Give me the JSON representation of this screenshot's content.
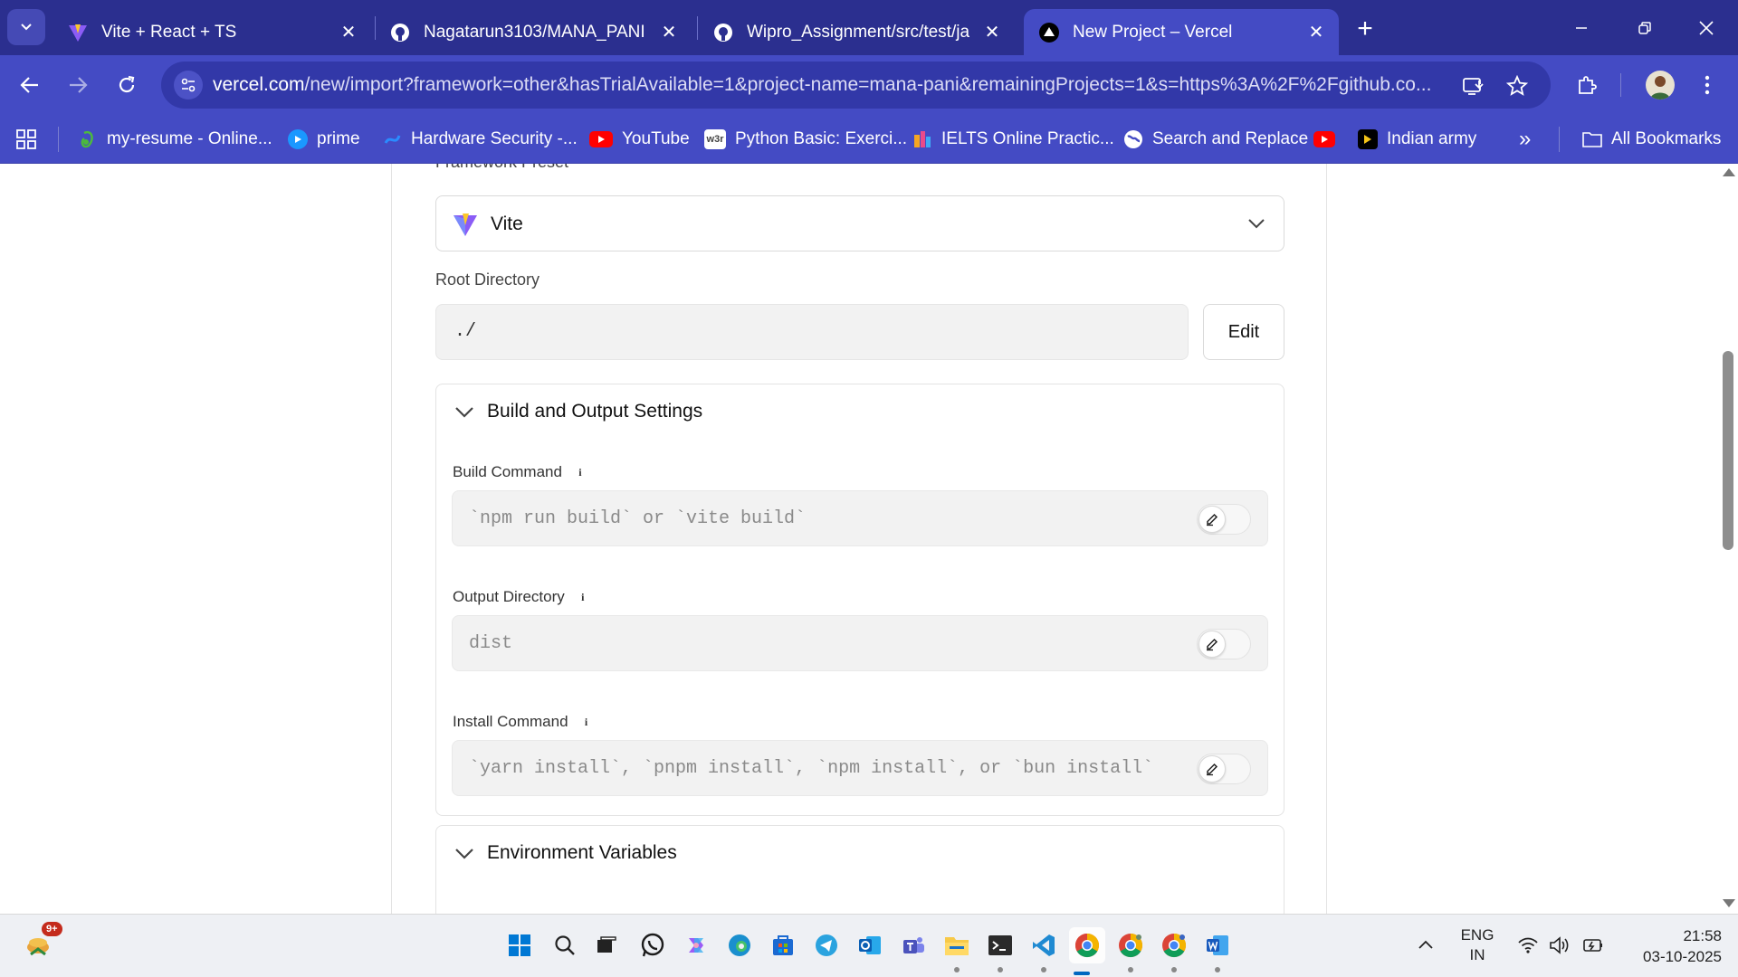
{
  "browser": {
    "tabs": [
      {
        "title": "Vite + React + TS",
        "icon": "vite-icon",
        "active": false
      },
      {
        "title": "Nagatarun3103/MANA_PANI",
        "icon": "github-icon",
        "active": false
      },
      {
        "title": "Wipro_Assignment/src/test/java",
        "icon": "github-icon",
        "active": false
      },
      {
        "title": "New Project – Vercel",
        "icon": "vercel-icon",
        "active": true
      }
    ],
    "new_tab_label": "+",
    "url_host": "vercel.com",
    "url_path": "/new/import?framework=other&hasTrialAvailable=1&project-name=mana-pani&remainingProjects=1&s=https%3A%2F%2Fgithub.co...",
    "bookmarks": [
      {
        "label": "my-resume - Online...",
        "icon": "overleaf-icon"
      },
      {
        "label": "prime",
        "icon": "prime-icon"
      },
      {
        "label": "Hardware Security -...",
        "icon": "hardware-icon"
      },
      {
        "label": "YouTube",
        "icon": "youtube-icon"
      },
      {
        "label": "Python Basic: Exerci...",
        "icon": "w3r-icon"
      },
      {
        "label": "IELTS Online Practic...",
        "icon": "ielts-icon"
      },
      {
        "label": "Search and Replace",
        "icon": "globe-icon"
      },
      {
        "label": "",
        "icon": "youtube-icon"
      },
      {
        "label": "Indian army",
        "icon": "play-icon"
      }
    ],
    "more_bookmarks_label": "»",
    "all_bookmarks_label": "All Bookmarks"
  },
  "form": {
    "framework_label": "Framework Preset",
    "framework_value": "Vite",
    "root_label": "Root Directory",
    "root_value": "./",
    "edit_label": "Edit",
    "build_section_title": "Build and Output Settings",
    "build_command_label": "Build Command",
    "build_command_placeholder": "`npm run build` or `vite build`",
    "output_dir_label": "Output Directory",
    "output_dir_placeholder": "dist",
    "install_command_label": "Install Command",
    "install_command_placeholder": "`yarn install`, `pnpm install`, `npm install`, or `bun install`",
    "env_section_title": "Environment Variables",
    "info_glyph": "i"
  },
  "taskbar": {
    "notification_badge": "9+",
    "language": "ENG",
    "region": "IN",
    "time": "21:58",
    "date": "03-10-2025"
  },
  "colors": {
    "chrome_dark": "#2b2f8f",
    "chrome_accent": "#444bc4",
    "vite_purple": "#8b5cf6",
    "vite_yellow": "#fcc72b"
  }
}
